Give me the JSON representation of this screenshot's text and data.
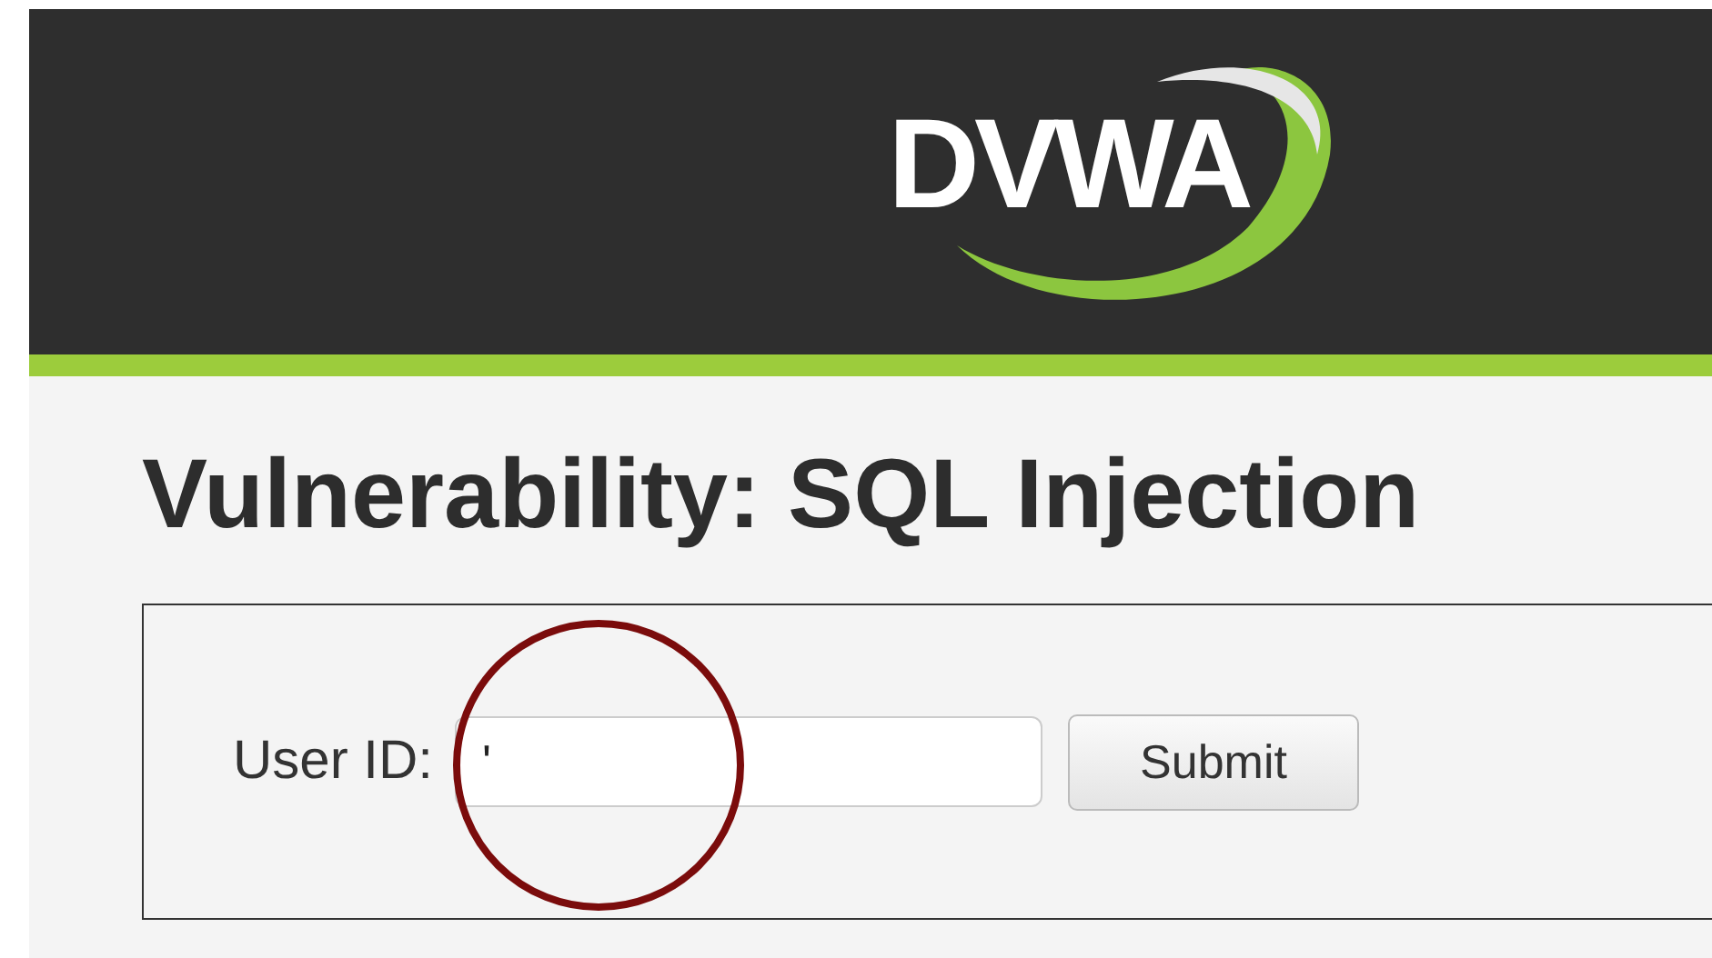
{
  "header": {
    "logo": "DVWA"
  },
  "title": "Vulnerability: SQL Injection",
  "form": {
    "label": "User ID:",
    "input_value": "'",
    "button": "Submit"
  },
  "annotation": {
    "kind": "circle"
  }
}
